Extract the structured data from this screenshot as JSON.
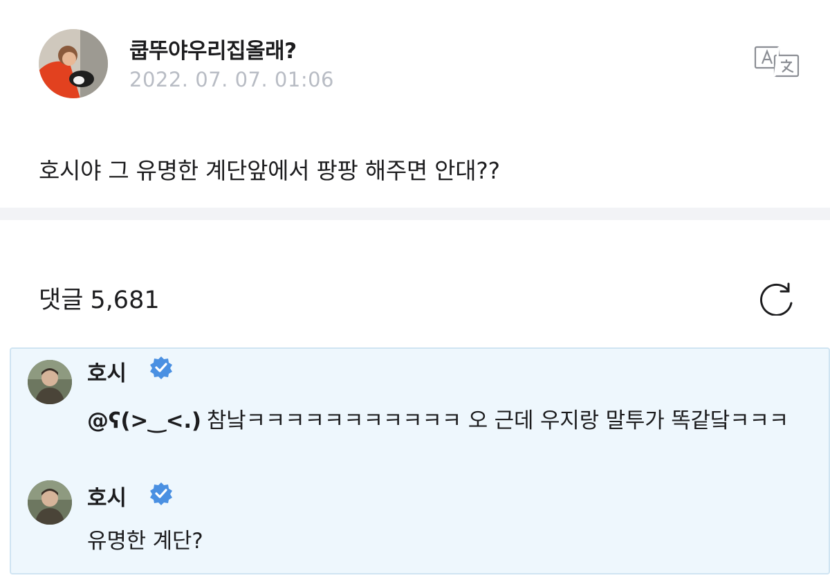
{
  "post": {
    "author": "쿱뚜야우리집올래?",
    "timestamp": "2022. 07. 07. 01:06",
    "body": "호시야 그 유명한 계단앞에서 팡팡 해주면 안대??",
    "translate_icon": "translate-icon"
  },
  "comments_header": {
    "label": "댓글",
    "count": "5,681",
    "refresh_icon": "refresh-icon"
  },
  "comments": [
    {
      "author": "호시",
      "verified": true,
      "mention": "@ʕ(>‿<.)",
      "text": "참낰ㅋㅋㅋㅋㅋㅋㅋㅋㅋㅋㅋ 오 근데 우지랑 말투가 똑같닼ㅋㅋㅋ"
    },
    {
      "author": "호시",
      "verified": true,
      "mention": "",
      "text": "유명한 계단?"
    }
  ],
  "colors": {
    "verified_badge": "#4a90e2",
    "panel_background": "#eef7fd",
    "timestamp": "#b8bcc4",
    "separator": "#f2f3f6"
  }
}
